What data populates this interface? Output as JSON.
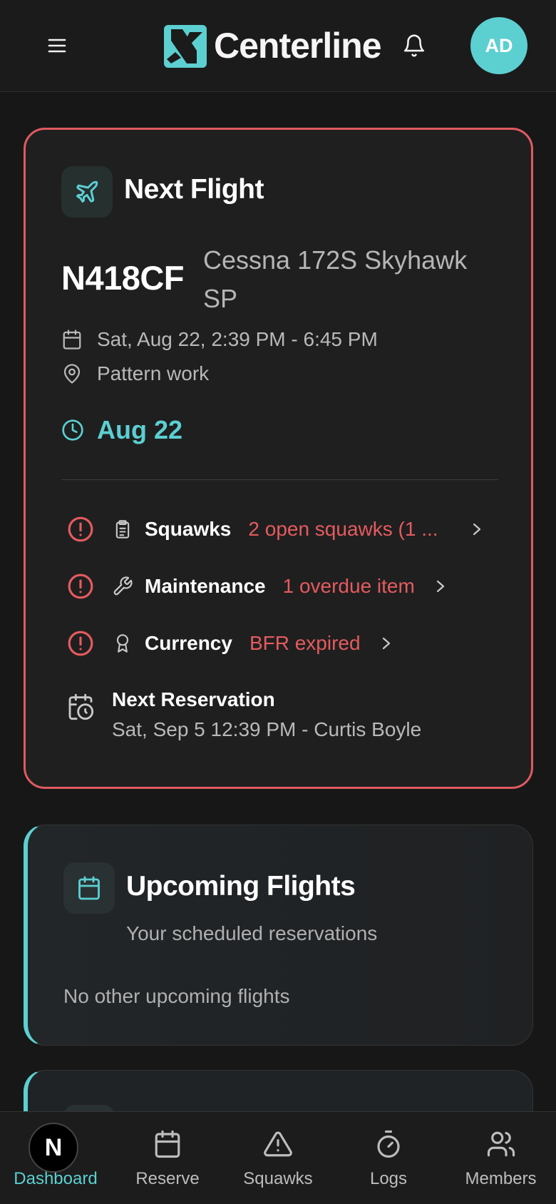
{
  "header": {
    "app_name": "Centerline",
    "avatar_initials": "AD",
    "accent_color": "#5ccfd1"
  },
  "next_flight": {
    "title": "Next Flight",
    "tail_number": "N418CF",
    "aircraft_model": "Cessna 172S Skyhawk SP",
    "time_range": "Sat, Aug 22, 2:39 PM - 6:45 PM",
    "location": "Pattern work",
    "countdown": "Aug 22",
    "alert_color": "#e05a5f",
    "checks": [
      {
        "label": "Squawks",
        "detail": "2 open squawks (1 ...",
        "icon": "clipboard-icon"
      },
      {
        "label": "Maintenance",
        "detail": "1 overdue item",
        "icon": "wrench-icon"
      },
      {
        "label": "Currency",
        "detail": "BFR expired",
        "icon": "award-icon"
      }
    ],
    "next_reservation": {
      "label": "Next Reservation",
      "value": "Sat, Sep 5 12:39 PM - Curtis Boyle"
    }
  },
  "upcoming": {
    "title": "Upcoming Flights",
    "subtitle": "Your scheduled reservations",
    "empty_text": "No other upcoming flights"
  },
  "bottom_nav": {
    "badge": "N",
    "items": [
      {
        "label": "Dashboard",
        "icon": "home-icon",
        "active": true
      },
      {
        "label": "Reserve",
        "icon": "calendar-icon",
        "active": false
      },
      {
        "label": "Squawks",
        "icon": "warning-icon",
        "active": false
      },
      {
        "label": "Logs",
        "icon": "stopwatch-icon",
        "active": false
      },
      {
        "label": "Members",
        "icon": "users-icon",
        "active": false
      }
    ]
  }
}
